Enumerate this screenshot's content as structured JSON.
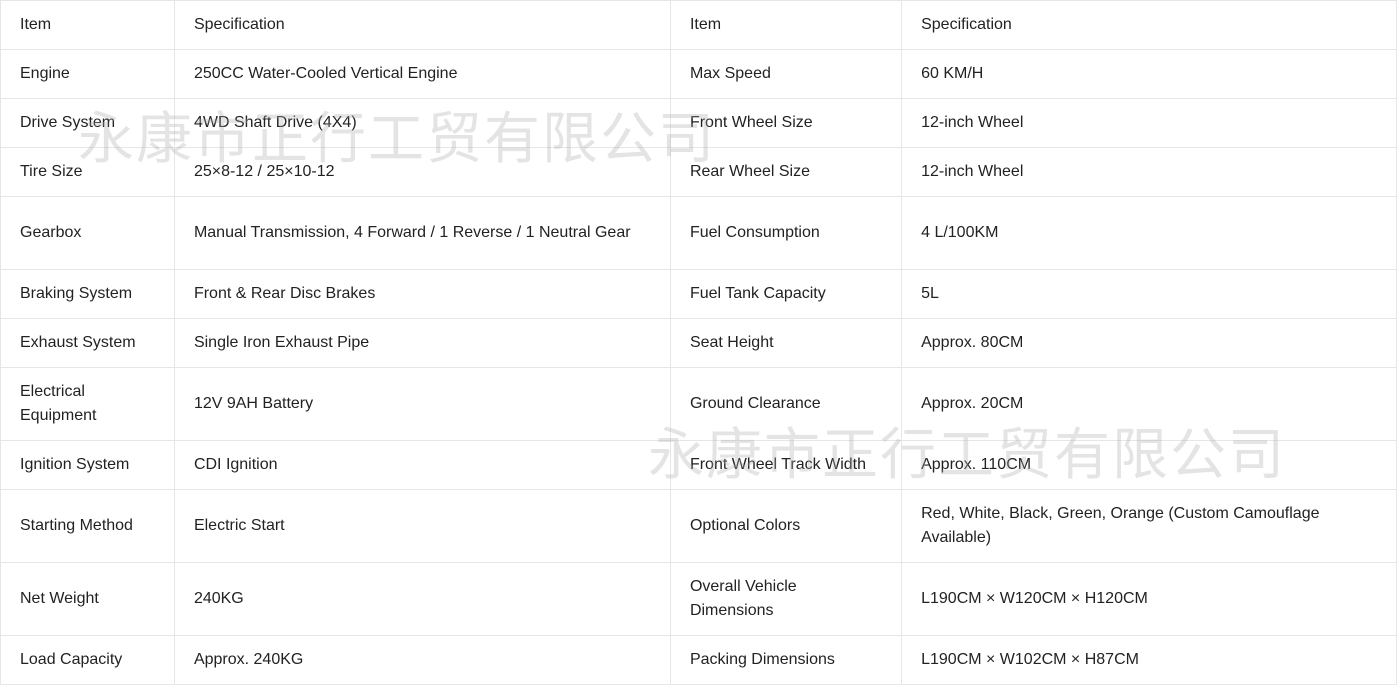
{
  "header": {
    "col1": "Item",
    "col2": "Specification",
    "col3": "Item",
    "col4": "Specification"
  },
  "rows": [
    [
      "Engine",
      "250CC Water-Cooled Vertical Engine",
      "Max Speed",
      "60 KM/H"
    ],
    [
      "Drive System",
      "4WD Shaft Drive (4X4)",
      "Front Wheel Size",
      "12-inch Wheel"
    ],
    [
      "Tire Size",
      "25×8-12 / 25×10-12",
      "Rear Wheel Size",
      "12-inch Wheel"
    ],
    [
      "Gearbox",
      "Manual Transmission, 4 Forward / 1 Reverse / 1 Neutral Gear",
      "Fuel Consumption",
      "4 L/100KM"
    ],
    [
      "Braking System",
      "Front & Rear Disc Brakes",
      "Fuel Tank Capacity",
      "5L"
    ],
    [
      "Exhaust System",
      "Single Iron Exhaust Pipe",
      "Seat Height",
      "Approx. 80CM"
    ],
    [
      "Electrical Equipment",
      "12V 9AH Battery",
      "Ground Clearance",
      "Approx. 20CM"
    ],
    [
      "Ignition System",
      "CDI Ignition",
      "Front Wheel Track Width",
      "Approx. 110CM"
    ],
    [
      "Starting Method",
      "Electric Start",
      "Optional Colors",
      "Red, White, Black, Green, Orange (Custom Camouflage Available)"
    ],
    [
      "Net Weight",
      "240KG",
      "Overall Vehicle Dimensions",
      "L190CM × W120CM × H120CM"
    ],
    [
      "Load Capacity",
      "Approx. 240KG",
      "Packing Dimensions",
      "L190CM × W102CM × H87CM"
    ]
  ],
  "watermark": {
    "text": "永康市正行工贸有限公司"
  }
}
